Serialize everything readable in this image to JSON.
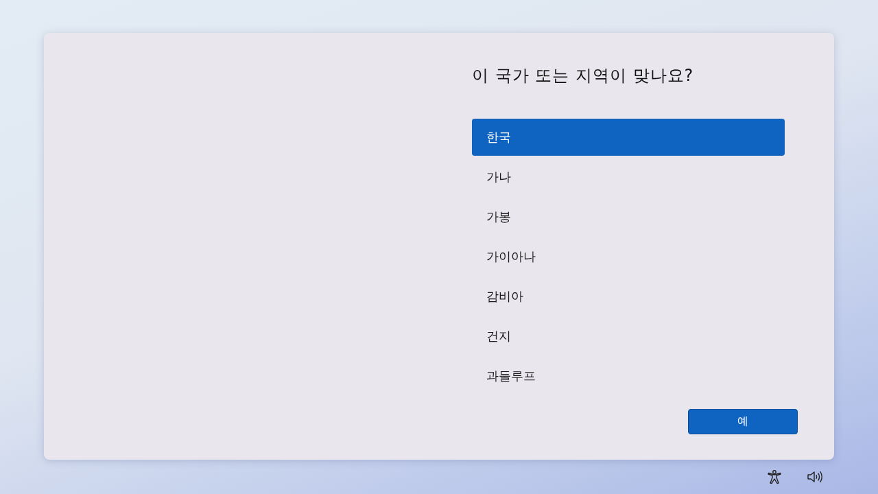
{
  "title": "이 국가 또는 지역이 맞나요?",
  "countries": [
    {
      "label": "한국",
      "selected": true
    },
    {
      "label": "가나",
      "selected": false
    },
    {
      "label": "가봉",
      "selected": false
    },
    {
      "label": "가이아나",
      "selected": false
    },
    {
      "label": "감비아",
      "selected": false
    },
    {
      "label": "건지",
      "selected": false
    },
    {
      "label": "과들루프",
      "selected": false
    }
  ],
  "confirm_button": "예"
}
